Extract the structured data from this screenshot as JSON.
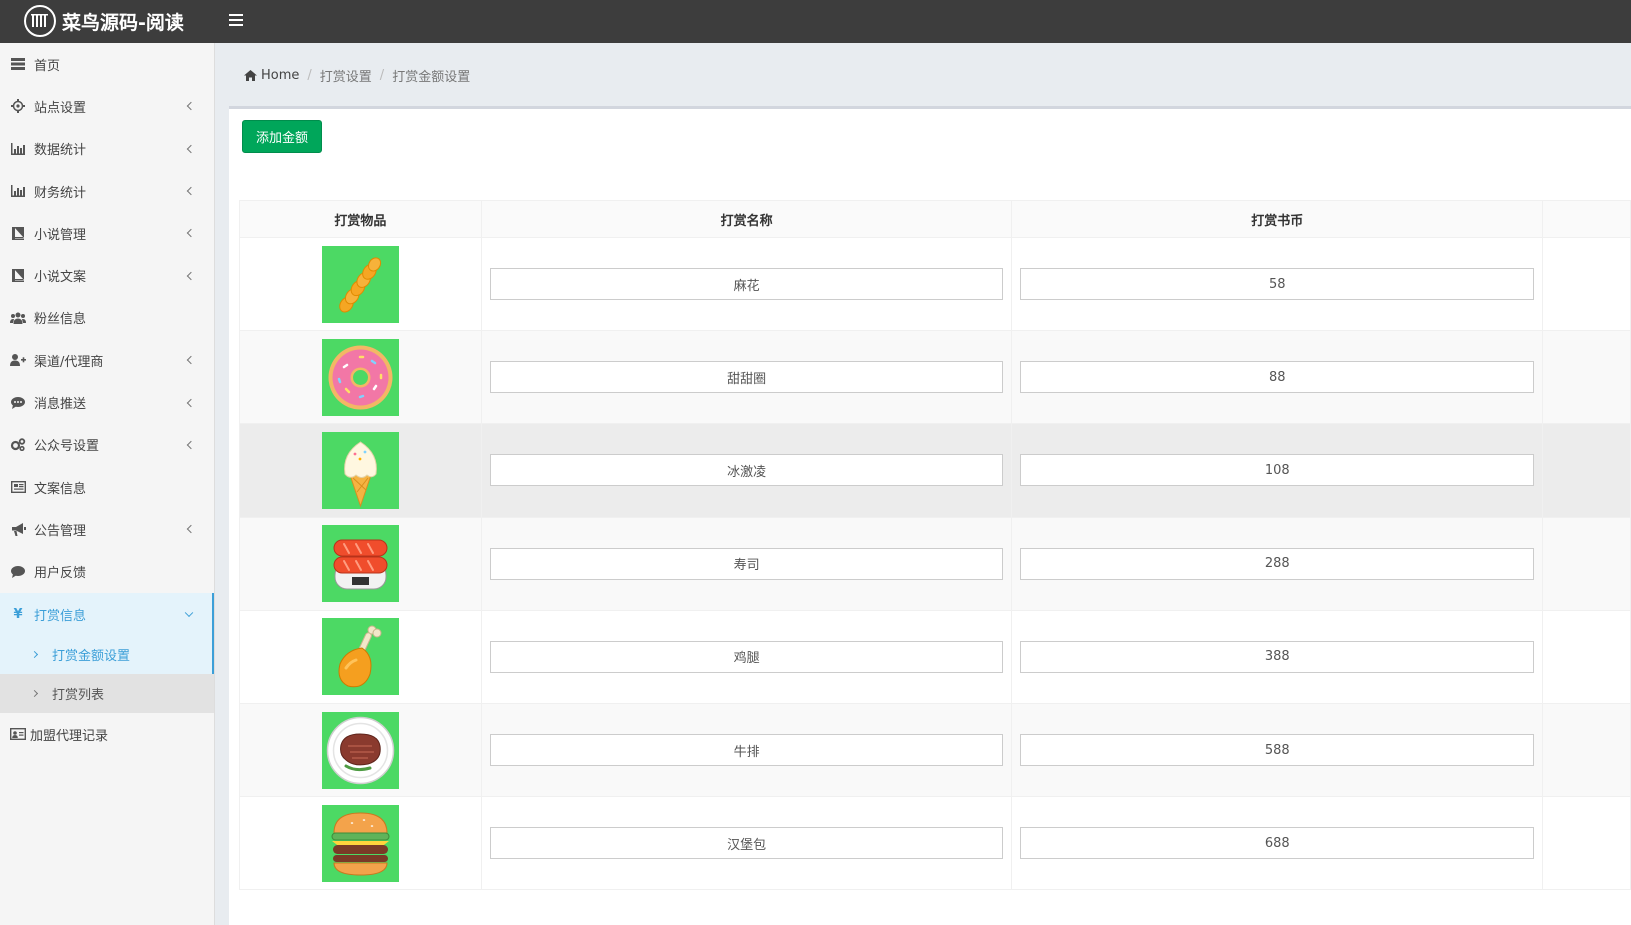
{
  "app": {
    "title": "菜鸟源码-阅读"
  },
  "sidebar": {
    "items": [
      {
        "label": "首页",
        "icon": "dashboard-icon",
        "has_children": false
      },
      {
        "label": "站点设置",
        "icon": "gear-icon",
        "has_children": true
      },
      {
        "label": "数据统计",
        "icon": "bar-chart-icon",
        "has_children": true
      },
      {
        "label": "财务统计",
        "icon": "bar-chart-icon",
        "has_children": true
      },
      {
        "label": "小说管理",
        "icon": "book-icon",
        "has_children": true
      },
      {
        "label": "小说文案",
        "icon": "book-icon",
        "has_children": true
      },
      {
        "label": "粉丝信息",
        "icon": "users-icon",
        "has_children": false
      },
      {
        "label": "渠道/代理商",
        "icon": "user-plus-icon",
        "has_children": true
      },
      {
        "label": "消息推送",
        "icon": "comment-dots-icon",
        "has_children": true
      },
      {
        "label": "公众号设置",
        "icon": "gears-icon",
        "has_children": true
      },
      {
        "label": "文案信息",
        "icon": "newspaper-icon",
        "has_children": false
      },
      {
        "label": "公告管理",
        "icon": "bullhorn-icon",
        "has_children": true
      },
      {
        "label": "用户反馈",
        "icon": "comment-icon",
        "has_children": false
      },
      {
        "label": "打赏信息",
        "icon": "yen-icon",
        "has_children": true,
        "active": true
      }
    ],
    "subitems": [
      {
        "label": "打赏金额设置",
        "active": true
      },
      {
        "label": "打赏列表",
        "active": false
      }
    ],
    "after": {
      "label": "加盟代理记录",
      "icon": "id-card-icon"
    }
  },
  "breadcrumb": {
    "home": "Home",
    "level1": "打赏设置",
    "level2": "打赏金额设置"
  },
  "toolbar": {
    "add_label": "添加金额"
  },
  "table": {
    "headers": [
      "打赏物品",
      "打赏名称",
      "打赏书币"
    ],
    "rows": [
      {
        "item": "twist-pastry",
        "name": "麻花",
        "coins": "58"
      },
      {
        "item": "donut",
        "name": "甜甜圈",
        "coins": "88"
      },
      {
        "item": "ice-cream",
        "name": "冰激凌",
        "coins": "108"
      },
      {
        "item": "sushi",
        "name": "寿司",
        "coins": "288"
      },
      {
        "item": "chicken-leg",
        "name": "鸡腿",
        "coins": "388"
      },
      {
        "item": "steak",
        "name": "牛排",
        "coins": "588"
      },
      {
        "item": "hamburger",
        "name": "汉堡包",
        "coins": "688"
      }
    ]
  },
  "colors": {
    "topbar": "#3d3d3d",
    "accent": "#3c9fd8",
    "add_button": "#00a65a",
    "thumb_bg": "#4cd964"
  }
}
